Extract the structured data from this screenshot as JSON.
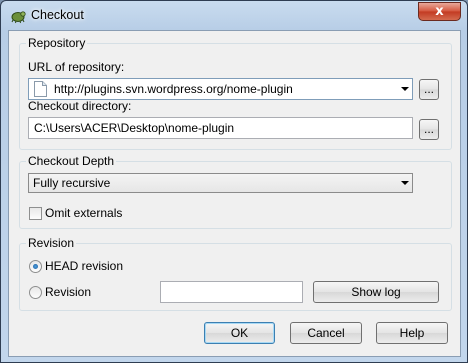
{
  "window": {
    "title": "Checkout",
    "close_label": "x"
  },
  "repository": {
    "group_label": "Repository",
    "url_label": "URL of repository:",
    "url_value": "http://plugins.svn.wordpress.org/nome-plugin",
    "browse_url_label": "...",
    "dir_label": "Checkout directory:",
    "dir_value": "C:\\Users\\ACER\\Desktop\\nome-plugin",
    "browse_dir_label": "..."
  },
  "depth": {
    "group_label": "Checkout Depth",
    "selected": "Fully recursive",
    "omit_externals_label": "Omit externals",
    "omit_externals_checked": false
  },
  "revision": {
    "group_label": "Revision",
    "head_label": "HEAD revision",
    "revision_label": "Revision",
    "selected": "head",
    "revision_value": "",
    "show_log_label": "Show log"
  },
  "buttons": {
    "ok": "OK",
    "cancel": "Cancel",
    "help": "Help"
  }
}
